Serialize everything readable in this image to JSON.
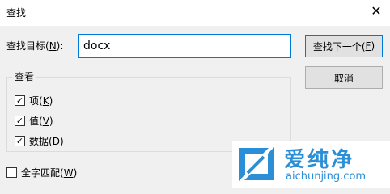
{
  "window": {
    "title": "查找",
    "close_glyph": "✕"
  },
  "find": {
    "label": "查找目标(",
    "label_key": "N",
    "label_end": "):",
    "value": "docx"
  },
  "buttons": {
    "find_next": {
      "label": "查找下一个(",
      "key": "F",
      "end": ")"
    },
    "cancel": {
      "label": "取消"
    }
  },
  "lookin": {
    "title": "查看",
    "items": [
      {
        "label": "项(",
        "key": "K",
        "end": ")",
        "checked": true
      },
      {
        "label": "值(",
        "key": "V",
        "end": ")",
        "checked": true
      },
      {
        "label": "数据(",
        "key": "D",
        "end": ")",
        "checked": true
      }
    ]
  },
  "whole_string": {
    "label": "全字匹配(",
    "key": "W",
    "end": ")",
    "checked": false
  },
  "watermark": {
    "text_cn": "爱纯净",
    "url": "aichunjing.com",
    "color": "#2a8fd6"
  }
}
